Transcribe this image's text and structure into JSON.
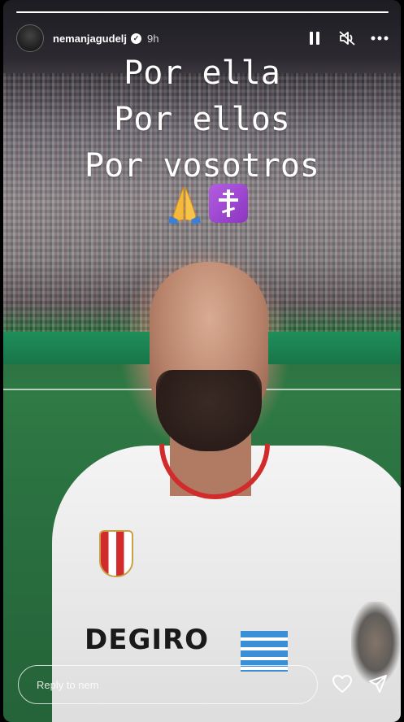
{
  "story": {
    "progress": 1.0,
    "author": {
      "username": "nemanjagudelj",
      "verified": true,
      "time_ago": "9h"
    },
    "caption_lines": [
      "Por ella",
      "Por ellos",
      "Por vosotros"
    ],
    "caption_emojis": [
      "folded-hands-emoji",
      "orthodox-cross-emoji"
    ],
    "media_text": {
      "sponsor": "DEGIRO"
    }
  },
  "header_controls": {
    "pause_icon": "pause-icon",
    "mute_icon": "muted-speaker-icon",
    "more_icon": "more-options-icon"
  },
  "reply": {
    "placeholder": "Reply to nem",
    "like_icon": "heart-icon",
    "share_icon": "send-icon"
  },
  "colors": {
    "accent_red": "#d22b2b",
    "text": "#ffffff"
  }
}
